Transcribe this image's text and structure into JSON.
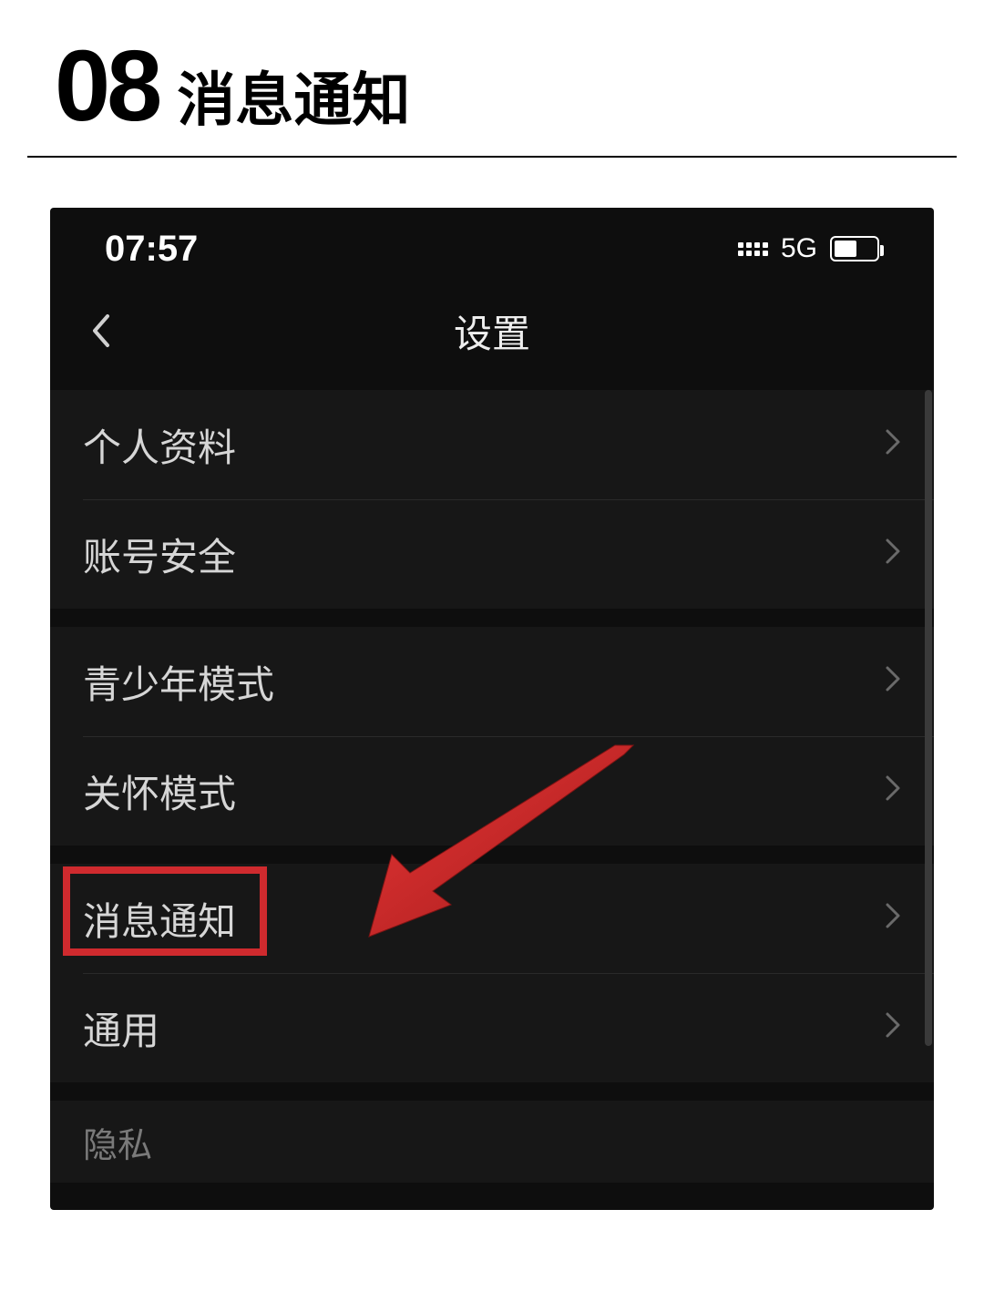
{
  "header": {
    "number": "08",
    "title": "消息通知"
  },
  "status_bar": {
    "time": "07:57",
    "network": "5G"
  },
  "nav": {
    "title": "设置"
  },
  "settings": {
    "group1": [
      {
        "label": "个人资料"
      },
      {
        "label": "账号安全"
      }
    ],
    "group2": [
      {
        "label": "青少年模式"
      },
      {
        "label": "关怀模式"
      }
    ],
    "group3": [
      {
        "label": "消息通知",
        "highlighted": true
      },
      {
        "label": "通用"
      }
    ],
    "group4_header": "隐私"
  },
  "annotation": {
    "highlight_color": "#cf2a2e",
    "arrow_color": "#c82322"
  }
}
